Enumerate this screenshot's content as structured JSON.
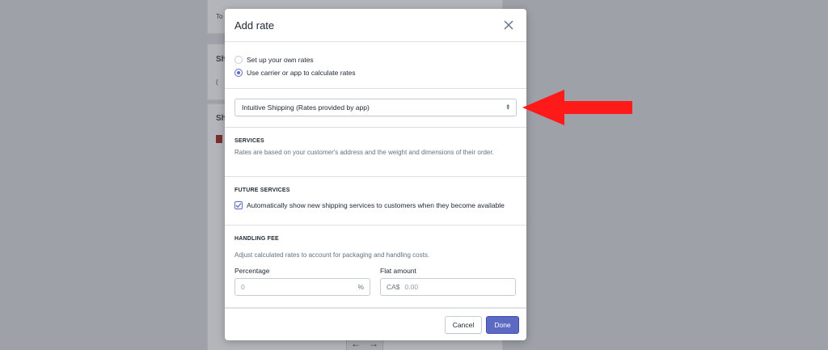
{
  "background": {
    "card1_text": "To",
    "card2_title": "Sh",
    "card2_sub": "(",
    "card3_title": "Sh",
    "nav_prev": "←",
    "nav_next": "→"
  },
  "modal": {
    "title": "Add rate",
    "close_icon": "close-icon",
    "radios": [
      {
        "label": "Set up your own rates",
        "selected": false
      },
      {
        "label": "Use carrier or app to calculate rates",
        "selected": true
      }
    ],
    "carrier_select": {
      "value": "Intuitive Shipping (Rates provided by app)"
    },
    "services": {
      "heading": "SERVICES",
      "description": "Rates are based on your customer's address and the weight and dimensions of their order."
    },
    "future_services": {
      "heading": "FUTURE SERVICES",
      "checkbox_label": "Automatically show new shipping services to customers when they become available",
      "checked": true
    },
    "handling_fee": {
      "heading": "HANDLING FEE",
      "description": "Adjust calculated rates to account for packaging and handling costs.",
      "percentage": {
        "label": "Percentage",
        "placeholder": "0",
        "suffix": "%"
      },
      "flat_amount": {
        "label": "Flat amount",
        "prefix": "CA$",
        "placeholder": "0.00"
      }
    },
    "footer": {
      "cancel_label": "Cancel",
      "done_label": "Done"
    }
  },
  "colors": {
    "accent": "#5c6ac4",
    "annotation_arrow": "#ff1a1a"
  }
}
